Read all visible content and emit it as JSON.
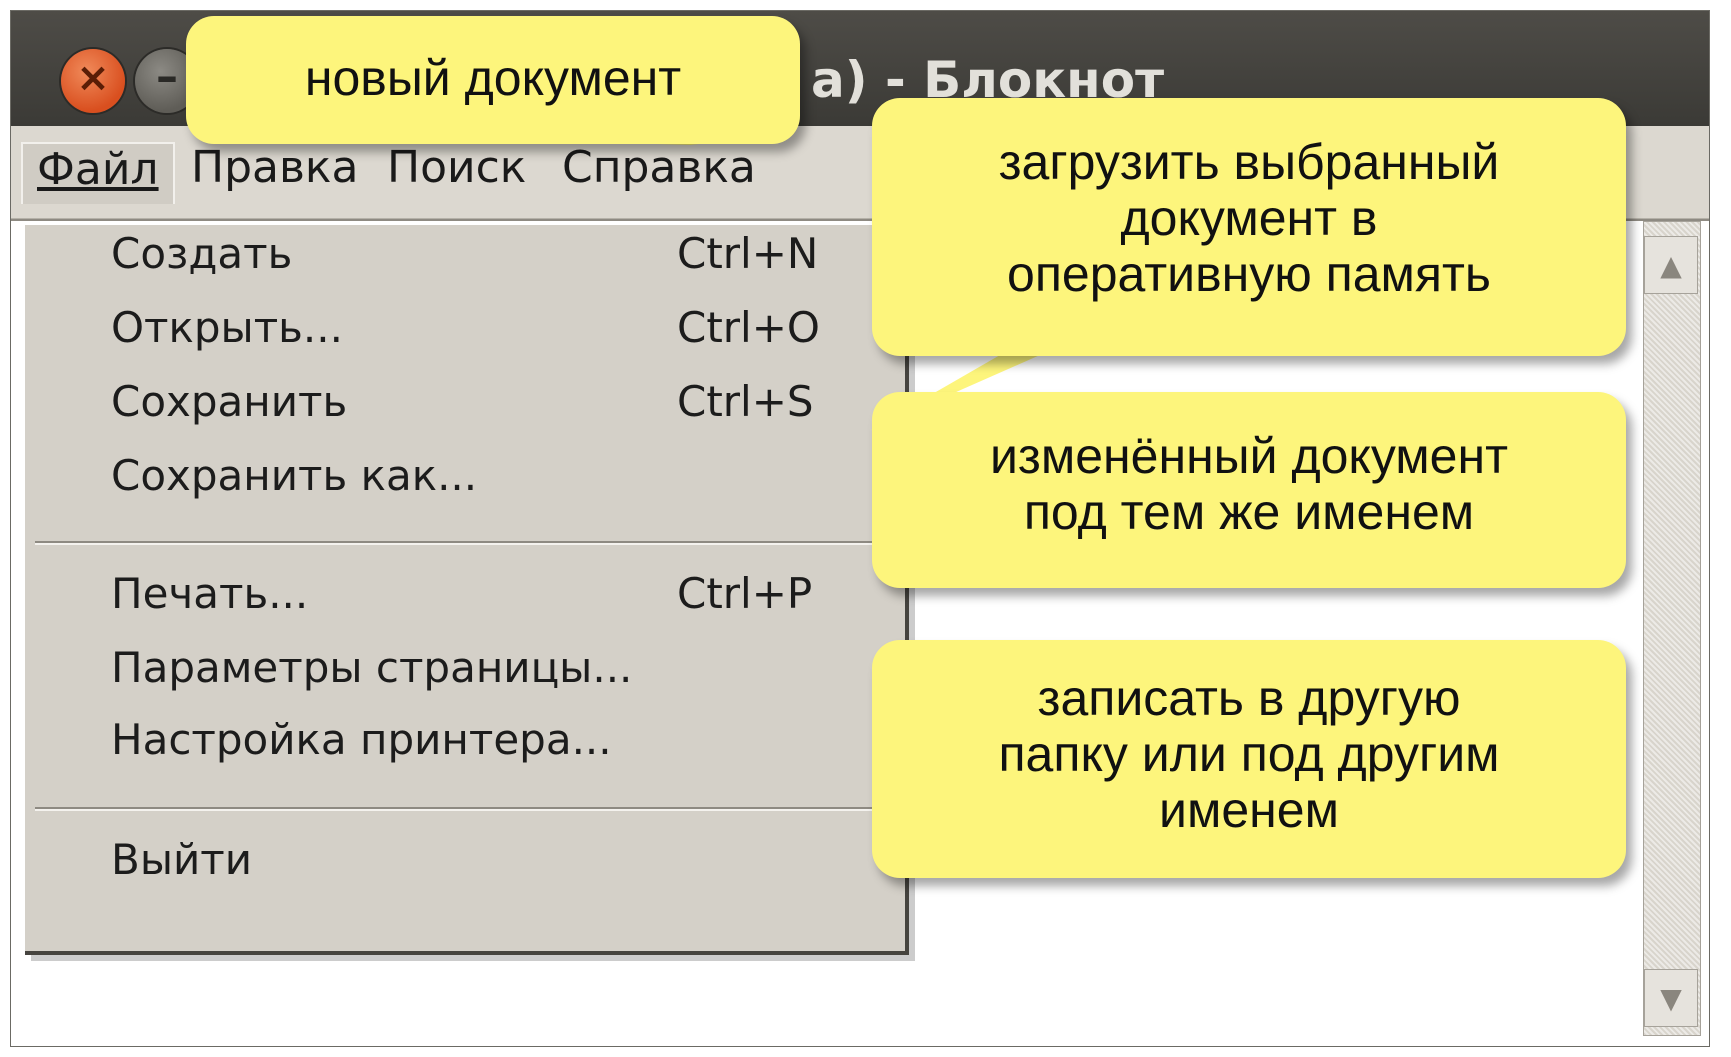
{
  "window": {
    "title": "а) - Блокнот"
  },
  "menubar": {
    "items": [
      {
        "label": "Файл",
        "active": true
      },
      {
        "label": "Правка"
      },
      {
        "label": "Поиск"
      },
      {
        "label": "Справка"
      }
    ]
  },
  "file_menu": {
    "items": [
      {
        "label": "Создать",
        "accel": "Ctrl+N"
      },
      {
        "label": "Открыть...",
        "accel": "Ctrl+O"
      },
      {
        "label": "Сохранить",
        "accel": "Ctrl+S"
      },
      {
        "label": "Сохранить как...",
        "accel": ""
      },
      {
        "label": "Печать...",
        "accel": "Ctrl+P"
      },
      {
        "label": "Параметры страницы...",
        "accel": ""
      },
      {
        "label": "Настройка принтера...",
        "accel": ""
      },
      {
        "label": "Выйти",
        "accel": ""
      }
    ]
  },
  "callouts": {
    "new_doc": "новый документ",
    "open": [
      "загрузить выбранный",
      "документ в",
      "оперативную память"
    ],
    "save": [
      "изменённый документ",
      "под тем же именем"
    ],
    "save_as": [
      "записать в другую",
      "папку или под другим",
      "именем"
    ]
  },
  "colors": {
    "callout_fill": "#fdf57c",
    "titlebar": "#3f3d39",
    "menu_bg": "#d4d0c8",
    "close_button": "#e0622f"
  },
  "icons": {
    "close": "close-icon",
    "minimize": "minimize-icon",
    "scroll_up": "arrow-up-icon",
    "scroll_down": "arrow-down-icon"
  }
}
